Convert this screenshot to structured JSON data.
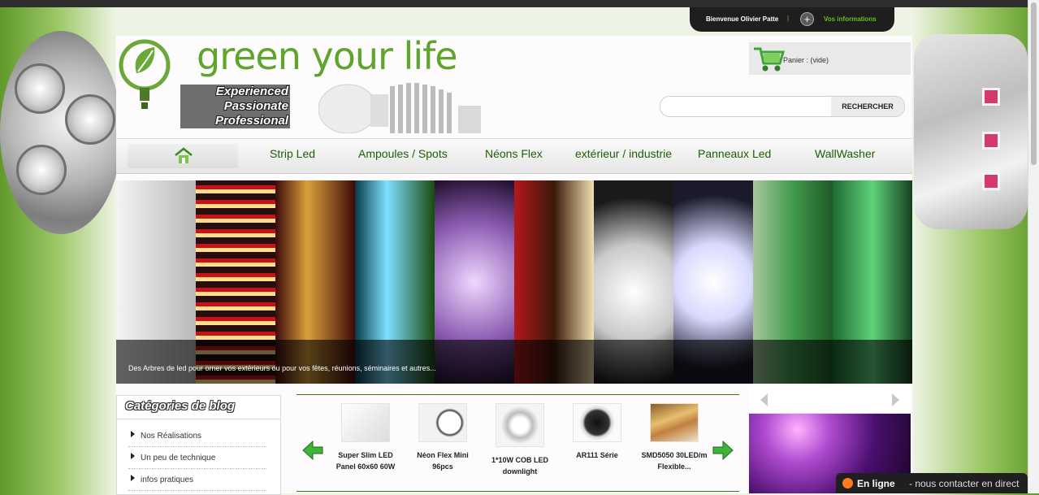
{
  "user_bar": {
    "welcome": "Bienvenue Olivier Patte",
    "separator": "|",
    "account_link": "Vos informations"
  },
  "logo": {
    "title": "green your life",
    "tagline": [
      "Experienced",
      "Passionate",
      "Professional"
    ]
  },
  "cart": {
    "label": "Panier : (vide)"
  },
  "search": {
    "placeholder": "",
    "button": "RECHERCHER"
  },
  "nav": {
    "items": [
      "Strip Led",
      "Ampoules / Spots",
      "Néons Flex",
      "extérieur / industrie",
      "Panneaux Led",
      "WallWasher"
    ]
  },
  "hero": {
    "caption": "Des Arbres de led pour orner vos extérieurs ou pour vos fêtes, réunions, séminaires et autres..."
  },
  "sidebar": {
    "title": "Catégories de blog",
    "items": [
      "Nos Réalisations",
      "Un peu de technique",
      "infos pratiques"
    ]
  },
  "products": [
    {
      "name": "Super Slim LED Panel 60x60 60W"
    },
    {
      "name": "Néon Flex Mini 96pcs"
    },
    {
      "name": "1*10W COB LED downlight"
    },
    {
      "name": "AR111 Série"
    },
    {
      "name": "SMD5050 30LED/m Flexible..."
    }
  ],
  "chat": {
    "status": "En ligne",
    "text": "- nous contacter en direct"
  },
  "colors": {
    "brand_green": "#5ea52b",
    "nav_text": "#1d5e06",
    "accent_link": "#62c01f"
  }
}
